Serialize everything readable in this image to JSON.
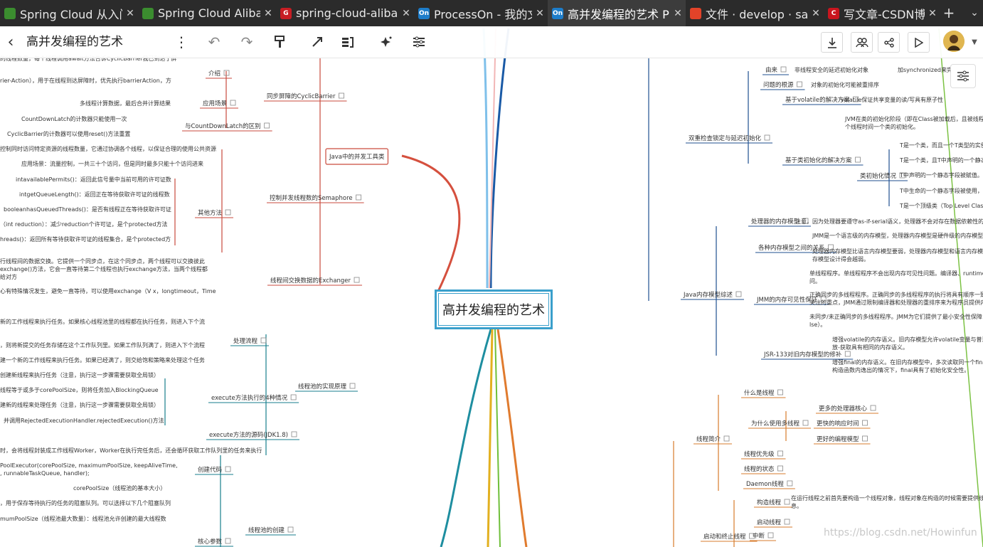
{
  "tabs": [
    {
      "title": "Spring Cloud 从入门",
      "icon": "avatar-favicon-icon",
      "color": "#3b8d2f",
      "glyph": ""
    },
    {
      "title": "Spring Cloud Aliba",
      "icon": "avatar-favicon-icon",
      "color": "#3b8d2f",
      "glyph": ""
    },
    {
      "title": "spring-cloud-aliba",
      "icon": "gitee-favicon-icon",
      "color": "#c71d23",
      "glyph": "G"
    },
    {
      "title": "ProcessOn - 我的文",
      "icon": "processon-favicon-icon",
      "color": "#1d7dca",
      "glyph": "On"
    },
    {
      "title": "高并发编程的艺术 P",
      "icon": "processon-favicon-icon",
      "color": "#1d7dca",
      "glyph": "On"
    },
    {
      "title": "文件 · develop · sa",
      "icon": "gitlab-favicon-icon",
      "color": "#e24329",
      "glyph": ""
    },
    {
      "title": "写文章-CSDN博客",
      "icon": "csdn-favicon-icon",
      "color": "#c9151e",
      "glyph": "C"
    }
  ],
  "toolbar": {
    "doc_title": "高并发编程的艺术"
  },
  "central_topic": "高并发编程的艺术",
  "watermark": "https://blog.csdn.net/Howinfun",
  "nodes": [
    [
      "Java中的并发工具类",
      463,
      219,
      "#c94a3c",
      1
    ],
    [
      "同步屏障的CyclicBarrier",
      375,
      134,
      "#c94a3c",
      0
    ],
    [
      "介绍",
      293,
      102,
      "#c94a3c",
      0
    ],
    [
      "应用场景",
      285,
      144,
      "#c94a3c",
      0
    ],
    [
      "与CountDownLatch的区别",
      260,
      176,
      "#c94a3c",
      0
    ],
    [
      "控制并发线程数的Semaphore",
      379,
      277,
      "#c94a3c",
      0
    ],
    [
      "其他方法",
      278,
      298,
      "#c94a3c",
      0
    ],
    [
      "线程间交换数据的Exchanger",
      380,
      393,
      "#c94a3c",
      0
    ],
    [
      "线程池的实现原理",
      419,
      542,
      "#177e8c",
      0
    ],
    [
      "处理流程",
      328,
      478,
      "#177e8c",
      0
    ],
    [
      "execute方法执行的4种情况",
      297,
      558,
      "#177e8c",
      0
    ],
    [
      "execute方法的源码(JDK1.8)",
      294,
      610,
      "#177e8c",
      0
    ],
    [
      "线程池的创建",
      349,
      744,
      "#177e8c",
      0
    ],
    [
      "创建代码",
      278,
      659,
      "#177e8c",
      0
    ],
    [
      "核心参数",
      278,
      760,
      "#177e8c",
      0
    ],
    [
      "双重检查锁定与延迟初始化",
      968,
      193,
      "#1f4f8f",
      0
    ],
    [
      "由来",
      1076,
      97,
      "#1f4f8f",
      0
    ],
    [
      "问题的根源",
      1073,
      118,
      "#1f4f8f",
      0
    ],
    [
      "基于volatile的解决方案",
      1104,
      139,
      "#1f4f8f",
      0
    ],
    [
      "基于类初始化的解决方案",
      1104,
      224,
      "#1f4f8f",
      0
    ],
    [
      "类初始化情况",
      1209,
      246,
      "#1f4f8f",
      0
    ],
    [
      "Java内存模型综述",
      961,
      413,
      "#1f4f8f",
      0
    ],
    [
      "处理器的内存模型",
      1056,
      310,
      "#1f4f8f",
      0
    ],
    [
      "各种内存模型之间的关系",
      1066,
      347,
      "#1f4f8f",
      0
    ],
    [
      "JMM的内存可见性保证",
      1064,
      420,
      "#1f4f8f",
      0
    ],
    [
      "JSR-133对旧内存模型的修补",
      1074,
      497,
      "#1f4f8f",
      0
    ],
    [
      "线程简介",
      979,
      616,
      "#d77b2c",
      0
    ],
    [
      "什么是线程",
      1046,
      551,
      "#d77b2c",
      0
    ],
    [
      "为什么使用多线程",
      1056,
      594,
      "#d77b2c",
      0
    ],
    [
      "更多的处理器核心",
      1151,
      573,
      "#d77b2c",
      0
    ],
    [
      "更快的响应时间",
      1148,
      594,
      "#d77b2c",
      0
    ],
    [
      "更好的编程模型",
      1148,
      616,
      "#d77b2c",
      0
    ],
    [
      "线程优先级",
      1046,
      637,
      "#d77b2c",
      0
    ],
    [
      "线程的状态",
      1046,
      658,
      "#d77b2c",
      0
    ],
    [
      "Daemon线程",
      1049,
      679,
      "#d77b2c",
      0
    ],
    [
      "启动和终止线程",
      989,
      753,
      "#d77b2c",
      0
    ],
    [
      "构造线程",
      1064,
      705,
      "#d77b2c",
      0
    ],
    [
      "启动线程",
      1064,
      733,
      "#d77b2c",
      0
    ],
    [
      "中断",
      1058,
      752,
      "#d77b2c",
      0
    ]
  ],
  "texts": [
    [
      "的线程数量，每个线程调用await方法告诉CyclicBarrier我已到达了屏",
      0,
      81
    ],
    [
      "rier-Action），用于在线程到达屏障时，优先执行barrierAction，方",
      0,
      112
    ],
    [
      "多线程计算数据，最后合并计算结果",
      112,
      144
    ],
    [
      "CountDownLatch的计数器只能使用一次",
      30,
      166
    ],
    [
      "CyclicBarrier的计数器可以使用reset()方法重置",
      10,
      187
    ],
    [
      "控制同时访问特定资源的线程数量，它通过协调各个线程，以保证合理的使用公共资源",
      0,
      208
    ],
    [
      "应用场景：流量控制，一共三十个访问，但是同时最多只能十个访问进来",
      30,
      229
    ],
    [
      "intavailablePermits()：返回此信号量中当前可用的许可证数",
      22,
      251
    ],
    [
      "intgetQueueLength()：返回正在等待获取许可证的线程数",
      27,
      272
    ],
    [
      "booleanhasQueuedThreads()：是否有线程正在等待获取许可证",
      5,
      293
    ],
    [
      "（int reduction）：减少reduction个许可证，是个protected方法",
      0,
      314
    ],
    [
      "hreads()：返回所有等待获取许可证的线程集合，是个protected方",
      0,
      335
    ],
    [
      "行线程间的数据交换。它提供一个同步点，在这个同步点，两个线程可以交换彼此",
      0,
      366
    ],
    [
      "exchange()方法，它会一直等待第二个线程也执行exchange方法，当两个线程都",
      0,
      377
    ],
    [
      "给对方",
      0,
      388
    ],
    [
      "心有特殊情况发生，避免一直等待，可以使用exchange（V x，longtimeout，Time",
      0,
      408
    ],
    [
      "新的工作线程来执行任务。如果核心线程池里的线程都在执行任务，则进入下个流",
      0,
      451
    ],
    [
      "，则将新提交的任务存储在这个工作队列里。如果工作队列满了，则进入下个流程",
      0,
      484
    ],
    [
      "建一个新的工作线程来执行任务。如果已经满了，则交给饱和策略来处理这个任务",
      0,
      505
    ],
    [
      "创建新线程来执行任务（注意，执行这一步骤需要获取全局锁）",
      0,
      526
    ],
    [
      "线程等于或多于corePoolSize，则将任务加入BlockingQueue",
      0,
      547
    ],
    [
      "建新的线程来处理任务（注意，执行这一步骤需要获取全局锁）",
      0,
      568
    ],
    [
      "并调用RejectedExecutionHandler.rejectedExecution()方法",
      5,
      590
    ],
    [
      "时，会将线程封装成工作线程Worker，Worker在执行完任务后，还会循环获取工作队列里的任务来执行",
      0,
      632
    ],
    [
      "PoolExecutor(corePoolSize, maximumPoolSize, keepAliveTime,",
      0,
      653
    ],
    [
      ", runnableTaskQueue, handler);",
      0,
      664
    ],
    [
      "corePoolSize（线程池的基本大小）",
      103,
      685
    ],
    [
      "，用于保存等待执行的任务的阻塞队列。可以选择以下几个阻塞队列",
      0,
      706
    ],
    [
      "mumPoolSize（线程池最大数量）：线程池允许创建的最大线程数",
      0,
      728
    ],
    [
      "非线程安全的延迟初始化对象",
      1117,
      97
    ],
    [
      "加synchronized来完成",
      1262,
      97
    ],
    [
      "对象的初始化可能被重排序",
      1140,
      118
    ],
    [
      "volatile保证共享变量的读/写具有原子性",
      1182,
      139
    ],
    [
      "JVM在类的初始化阶段（即在Class被加载后，且被线程使用",
      1188,
      166
    ],
    [
      "个线程时间一个类的初始化。",
      1188,
      177
    ],
    [
      "T是一个类，而且一个T类型的实例",
      1265,
      203
    ],
    [
      "T是一个类，且T中声明的一个静态",
      1265,
      224
    ],
    [
      "T中声明的一个静态字段被赋值。",
      1265,
      245
    ],
    [
      "T中生命的一个静态字段被使用，",
      1265,
      267
    ],
    [
      "T是一个顶级类（Top Level Class",
      1265,
      288
    ],
    [
      "注意，因为处理器要遵守as-if-serial语义，处理器不会对存在数据依赖性的两",
      1118,
      310
    ],
    [
      "JMM是一个语言级的内存模型，处理器内存模型是硬件级的内存模型",
      1142,
      330
    ],
    [
      "处理器内存模型比语言内存模型要弱，处理器内存模型和语言内存模型",
      1142,
      352
    ],
    [
      "存模型设计得会越弱。",
      1142,
      363
    ],
    [
      "单线程程序。单线程程序不会出现内存可见性问题。编译器、runtime和",
      1138,
      383
    ],
    [
      "问。",
      1138,
      394
    ],
    [
      "正确同步的多线程程序。正确同步的多线程程序的执行将具有顺序一致",
      1138,
      413
    ],
    [
      "关注的重点，JMM通过限制编译器和处理器的重排序来为程序员提供内",
      1138,
      424
    ],
    [
      "未同步/未正确同步的多线程程序。JMM为它们提供了最小安全性保障：",
      1138,
      444
    ],
    [
      "lse）。",
      1138,
      455
    ],
    [
      "增强volatile的内存语义。旧内存模型允许volatile变量与普通",
      1170,
      476
    ],
    [
      "放-获取具有相同的内存语义。",
      1170,
      487
    ],
    [
      "增强final的内存语义。在旧内存模型中，多次读取同一个final",
      1170,
      508
    ],
    [
      "构造函数内逸出的情况下，final具有了初始化安全性。",
      1170,
      519
    ],
    [
      "在运行线程之前首先要构造一个线程对象，线程对象在构造的时候需要提供线",
      1112,
      699
    ],
    [
      "息。",
      1112,
      710
    ]
  ]
}
